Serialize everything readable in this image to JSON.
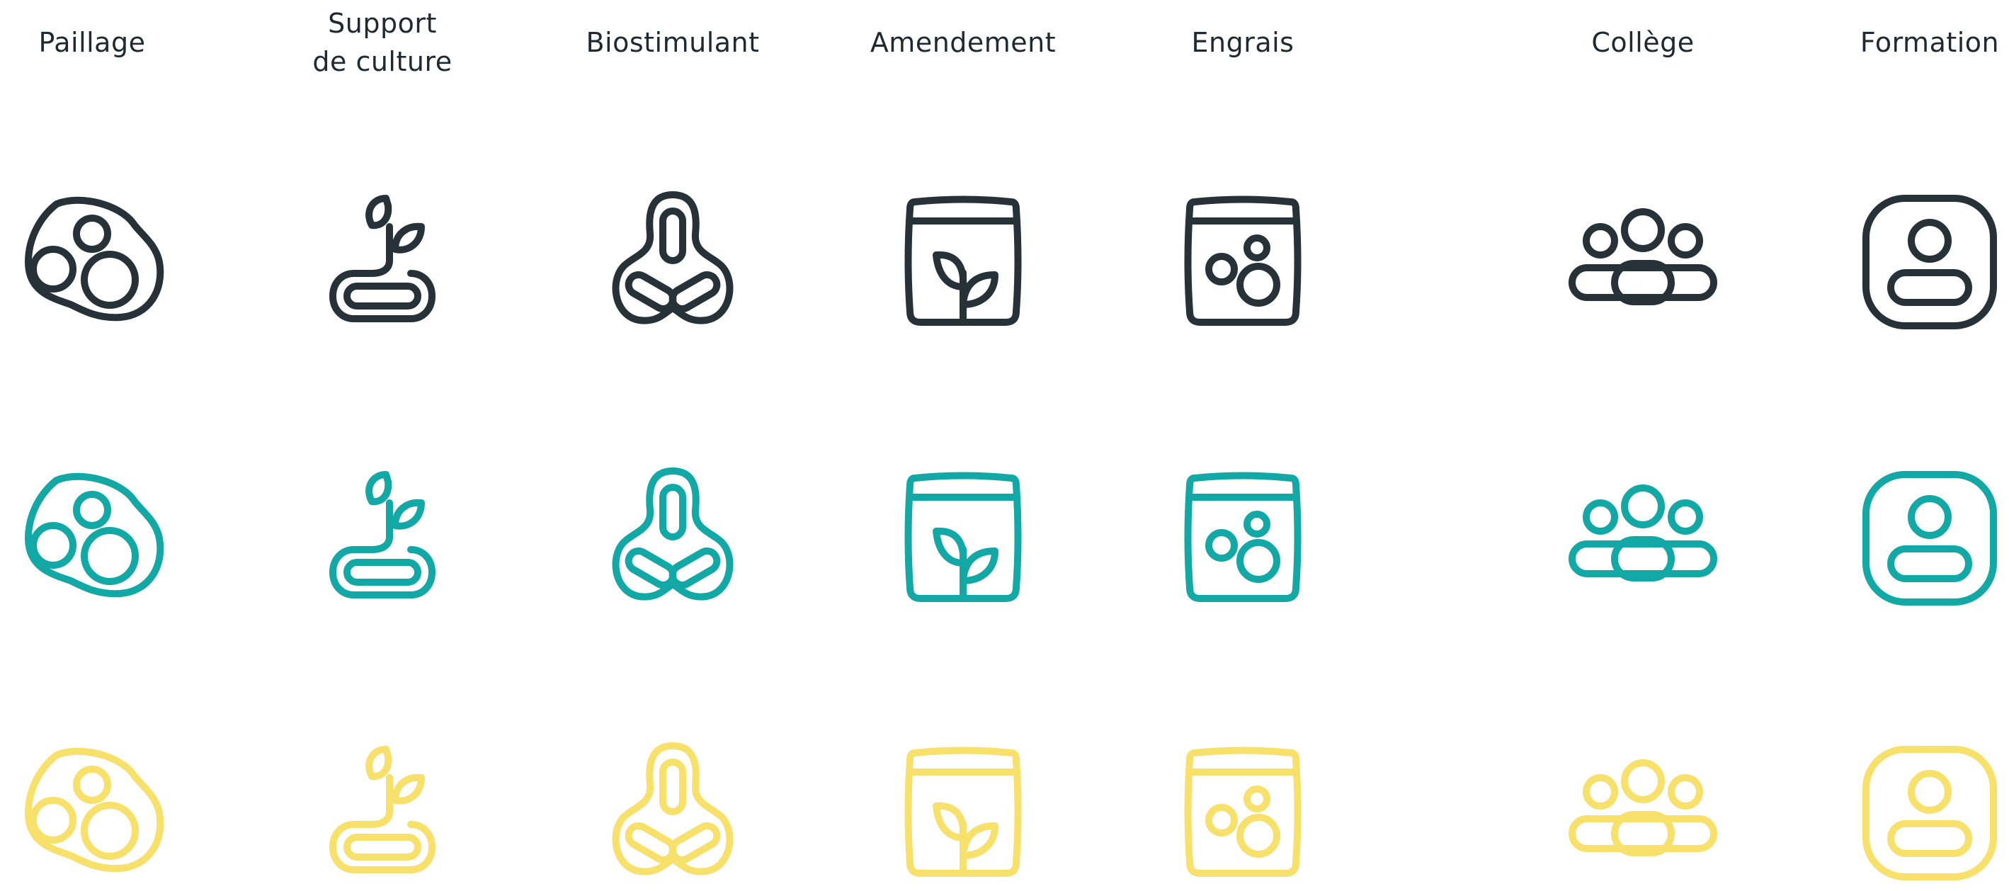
{
  "columns": [
    {
      "key": "paillage",
      "label": "Paillage",
      "icon": "mulch-cells-icon"
    },
    {
      "key": "support",
      "label": "Support\nde culture",
      "icon": "sprout-tray-icon"
    },
    {
      "key": "biostimulant",
      "label": "Biostimulant",
      "icon": "trefoil-icon"
    },
    {
      "key": "amendement",
      "label": "Amendement",
      "icon": "bag-leaf-icon"
    },
    {
      "key": "engrais",
      "label": "Engrais",
      "icon": "bag-granules-icon"
    },
    {
      "key": "college",
      "label": "Collège",
      "icon": "group-people-icon"
    },
    {
      "key": "formation",
      "label": "Formation",
      "icon": "person-badge-icon"
    }
  ],
  "rows": [
    {
      "variant": "dark",
      "color": "#263238"
    },
    {
      "variant": "teal",
      "color": "#12a8a5"
    },
    {
      "variant": "yellow",
      "color": "#f7e16b"
    }
  ]
}
